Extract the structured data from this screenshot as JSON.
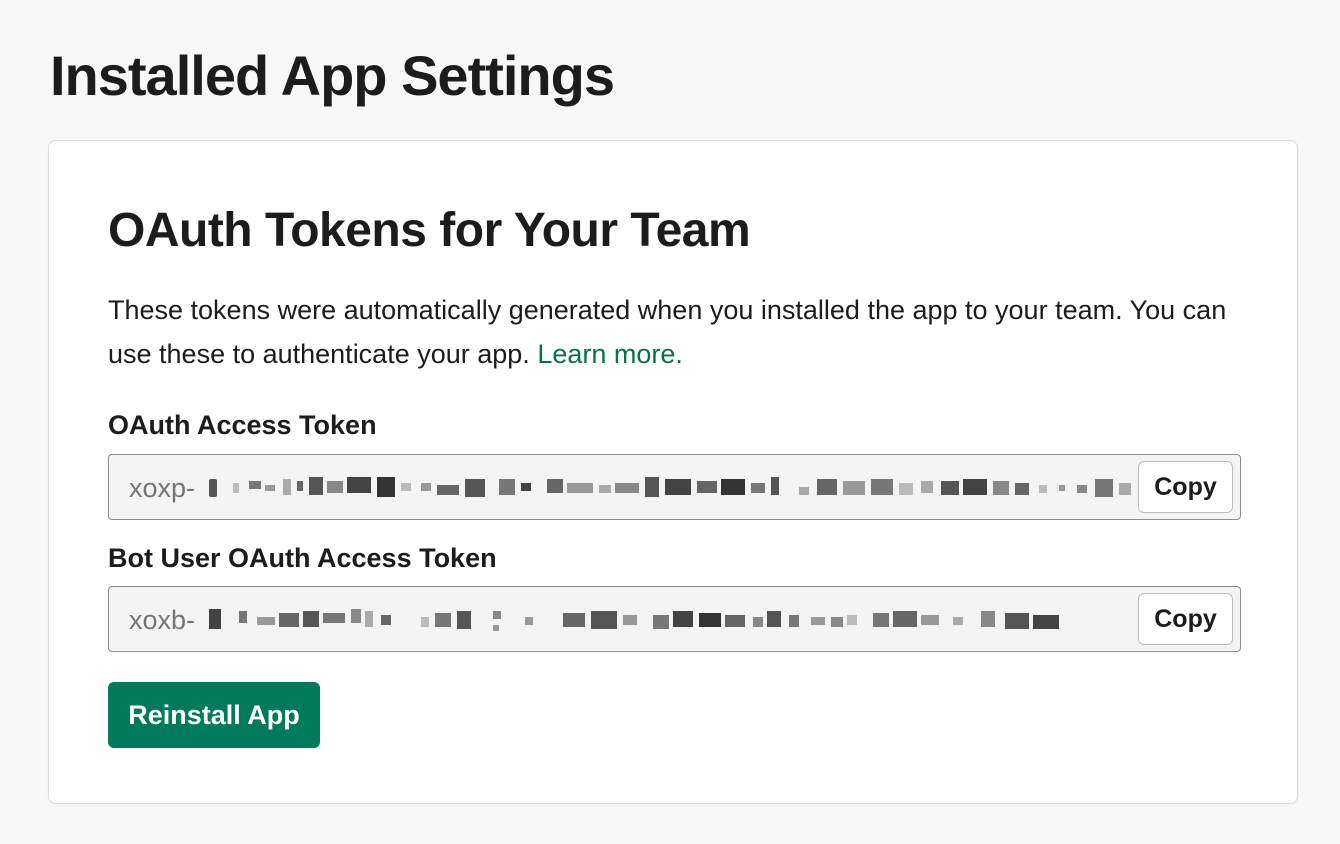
{
  "page": {
    "title": "Installed App Settings"
  },
  "oauth_card": {
    "title": "OAuth Tokens for Your Team",
    "description": "These tokens were automatically generated when you installed the app to your team. You can use these to authenticate your app.",
    "learn_more_label": "Learn more.",
    "user_token": {
      "label": "OAuth Access Token",
      "prefix": "xoxp-",
      "copy_label": "Copy"
    },
    "bot_token": {
      "label": "Bot User OAuth Access Token",
      "prefix": "xoxb-",
      "copy_label": "Copy"
    },
    "reinstall_label": "Reinstall App"
  },
  "colors": {
    "page_background": "#f8f8f8",
    "card_background": "#ffffff",
    "primary_button": "#007a5a",
    "link": "#0b6e4f",
    "token_field_background": "#f4f4f4"
  }
}
